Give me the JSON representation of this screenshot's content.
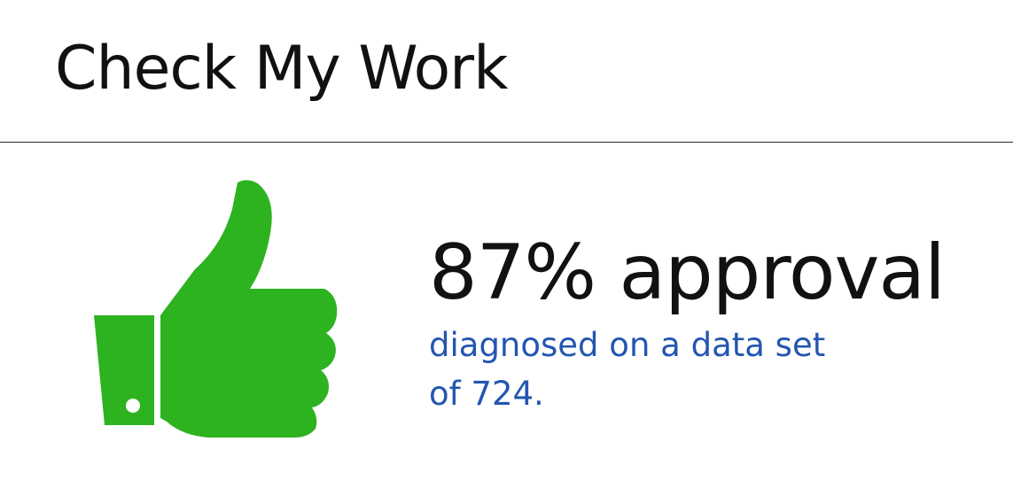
{
  "header": {
    "title": "Check My Work"
  },
  "result": {
    "headline": "87% approval",
    "detail": "diagnosed  on a data set of 724."
  },
  "icons": {
    "thumb": "thumbs-up-icon"
  },
  "colors": {
    "thumb": "#2cb31f",
    "title_text": "#111111",
    "detail_text": "#2356b0",
    "divider": "#2b2b2b",
    "background": "#ffffff"
  }
}
